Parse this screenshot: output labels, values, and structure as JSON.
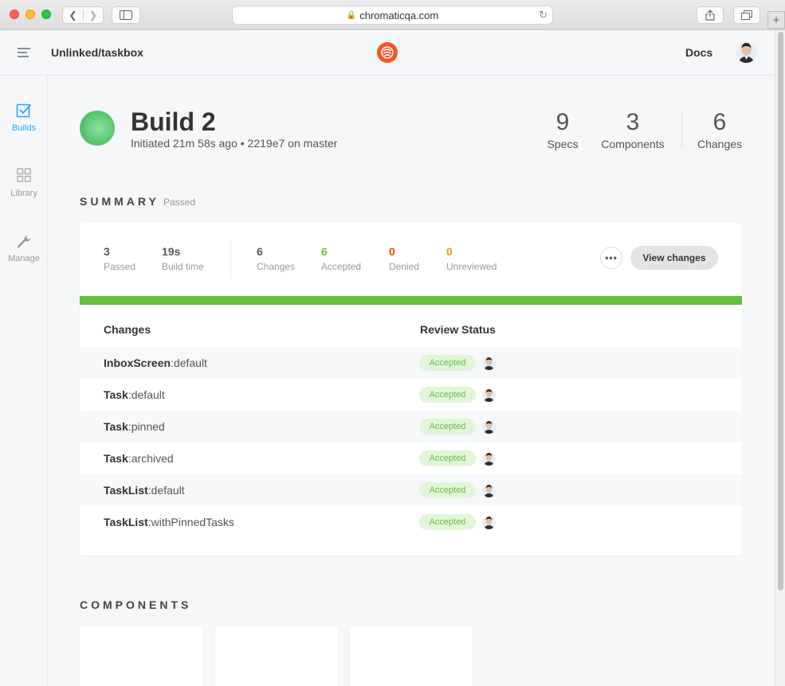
{
  "browser": {
    "url": "chromaticqa.com"
  },
  "header": {
    "project": "Unlinked/taskbox",
    "docs_label": "Docs"
  },
  "nav": [
    {
      "label": "Builds",
      "icon": "builds-checkbox-icon",
      "active": true
    },
    {
      "label": "Library",
      "icon": "library-grid-icon",
      "active": false
    },
    {
      "label": "Manage",
      "icon": "wrench-icon",
      "active": false
    }
  ],
  "build": {
    "title": "Build 2",
    "subtitle": "Initiated 21m 58s ago • 2219e7 on master",
    "stats": [
      {
        "value": "9",
        "label": "Specs"
      },
      {
        "value": "3",
        "label": "Components"
      },
      {
        "value": "6",
        "label": "Changes"
      }
    ]
  },
  "summary": {
    "title": "SUMMARY",
    "status": "Passed",
    "stats": [
      {
        "value": "3",
        "label": "Passed",
        "color": "#555555"
      },
      {
        "value": "19s",
        "label": "Build time",
        "color": "#555555"
      },
      {
        "value": "6",
        "label": "Changes",
        "color": "#555555"
      },
      {
        "value": "6",
        "label": "Accepted",
        "color": "#66bf3c"
      },
      {
        "value": "0",
        "label": "Denied",
        "color": "#ff4400"
      },
      {
        "value": "0",
        "label": "Unreviewed",
        "color": "#e6a600"
      }
    ],
    "more_label": "•••",
    "view_changes_label": "View changes",
    "progress_percent": 100,
    "progress_color": "#66bf3c"
  },
  "changes_table": {
    "headers": [
      "Changes",
      "Review Status"
    ],
    "rows": [
      {
        "component": "InboxScreen",
        "story": ":default",
        "status": "Accepted"
      },
      {
        "component": "Task",
        "story": ":default",
        "status": "Accepted"
      },
      {
        "component": "Task",
        "story": ":pinned",
        "status": "Accepted"
      },
      {
        "component": "Task",
        "story": ":archived",
        "status": "Accepted"
      },
      {
        "component": "TaskList",
        "story": ":default",
        "status": "Accepted"
      },
      {
        "component": "TaskList",
        "story": ":withPinnedTasks",
        "status": "Accepted"
      }
    ]
  },
  "components": {
    "title": "COMPONENTS"
  },
  "colors": {
    "accent": "#1ea7fd",
    "brand": "#fc521f",
    "accepted_bg": "#e1f5d9",
    "accepted_text": "#66bf3c"
  }
}
